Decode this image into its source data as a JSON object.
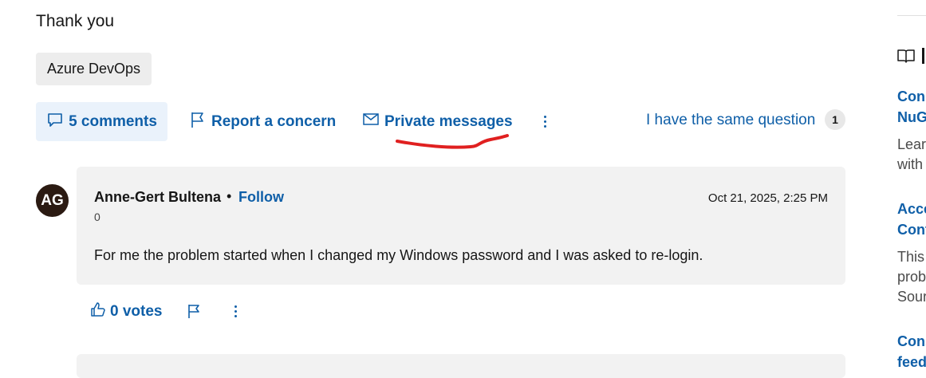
{
  "question": {
    "closing_text": "Thank you",
    "tag": "Azure DevOps"
  },
  "actions": {
    "comments_label": "5 comments",
    "report_label": "Report a concern",
    "private_label": "Private messages",
    "same_question_label": "I have the same question",
    "same_question_count": "1"
  },
  "comment": {
    "avatar_initials": "AG",
    "author": "Anne-Gert Bultena",
    "separator": "•",
    "follow_label": "Follow",
    "reputation": "0",
    "date": "Oct 21, 2025, 2:25 PM",
    "body": "For me the problem started when I changed my Windows password and I was asked to re-login.",
    "votes_label": "0 votes"
  },
  "sidebar": {
    "items": [
      {
        "title": "Conn\nNuG",
        "desc": "Lear\nwith"
      },
      {
        "title": "Acce\nCont",
        "desc": "This\nprob\nSour"
      },
      {
        "title": "Cons\nfeed",
        "desc": ""
      }
    ]
  },
  "colors": {
    "link": "#0f5fa8",
    "comments_button_bg": "#eaf2fb",
    "card_bg": "#f2f2f2",
    "annotation": "#e02020"
  },
  "icons": {
    "comments": "speech-bubble-icon",
    "report": "flag-icon",
    "private": "envelope-icon",
    "more": "vertical-ellipsis-icon",
    "votes": "thumbs-up-icon",
    "sidebar": "book-icon"
  }
}
